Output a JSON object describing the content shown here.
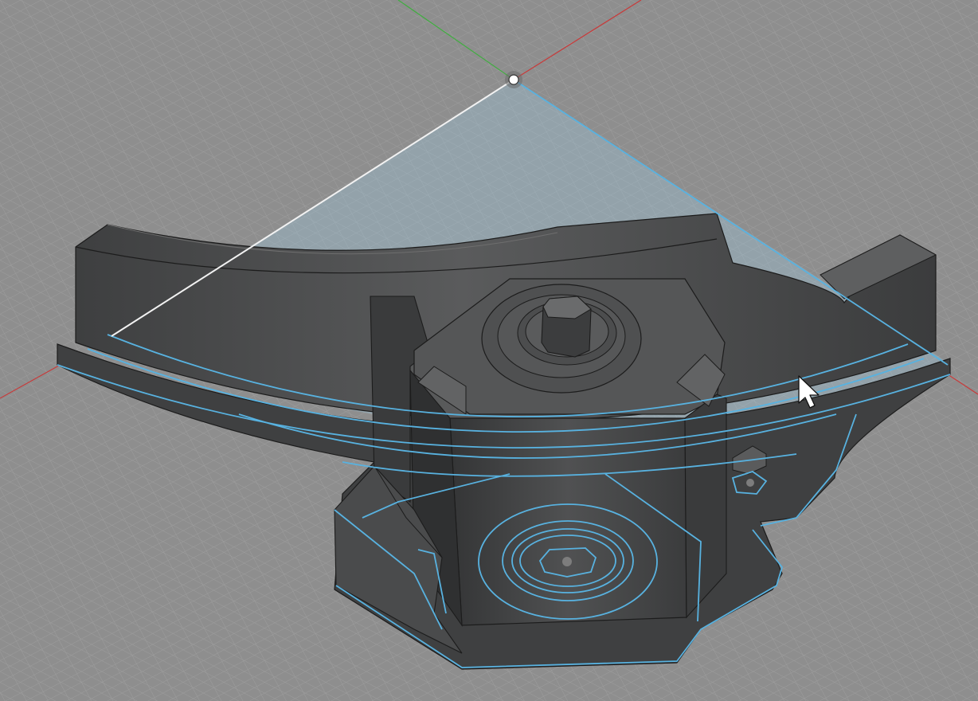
{
  "viewport": {
    "kind": "3d-cad-viewport",
    "background_color": "#8e8e8e",
    "grid_color": "#a9a9a9",
    "axis_x_color": "#c83a3a",
    "axis_y_color": "#3fae3f",
    "sketch_highlight_color": "#58b2e0",
    "body_color": "#4a4b4c"
  },
  "cursor": {
    "icon": "arrow-cursor-icon"
  }
}
